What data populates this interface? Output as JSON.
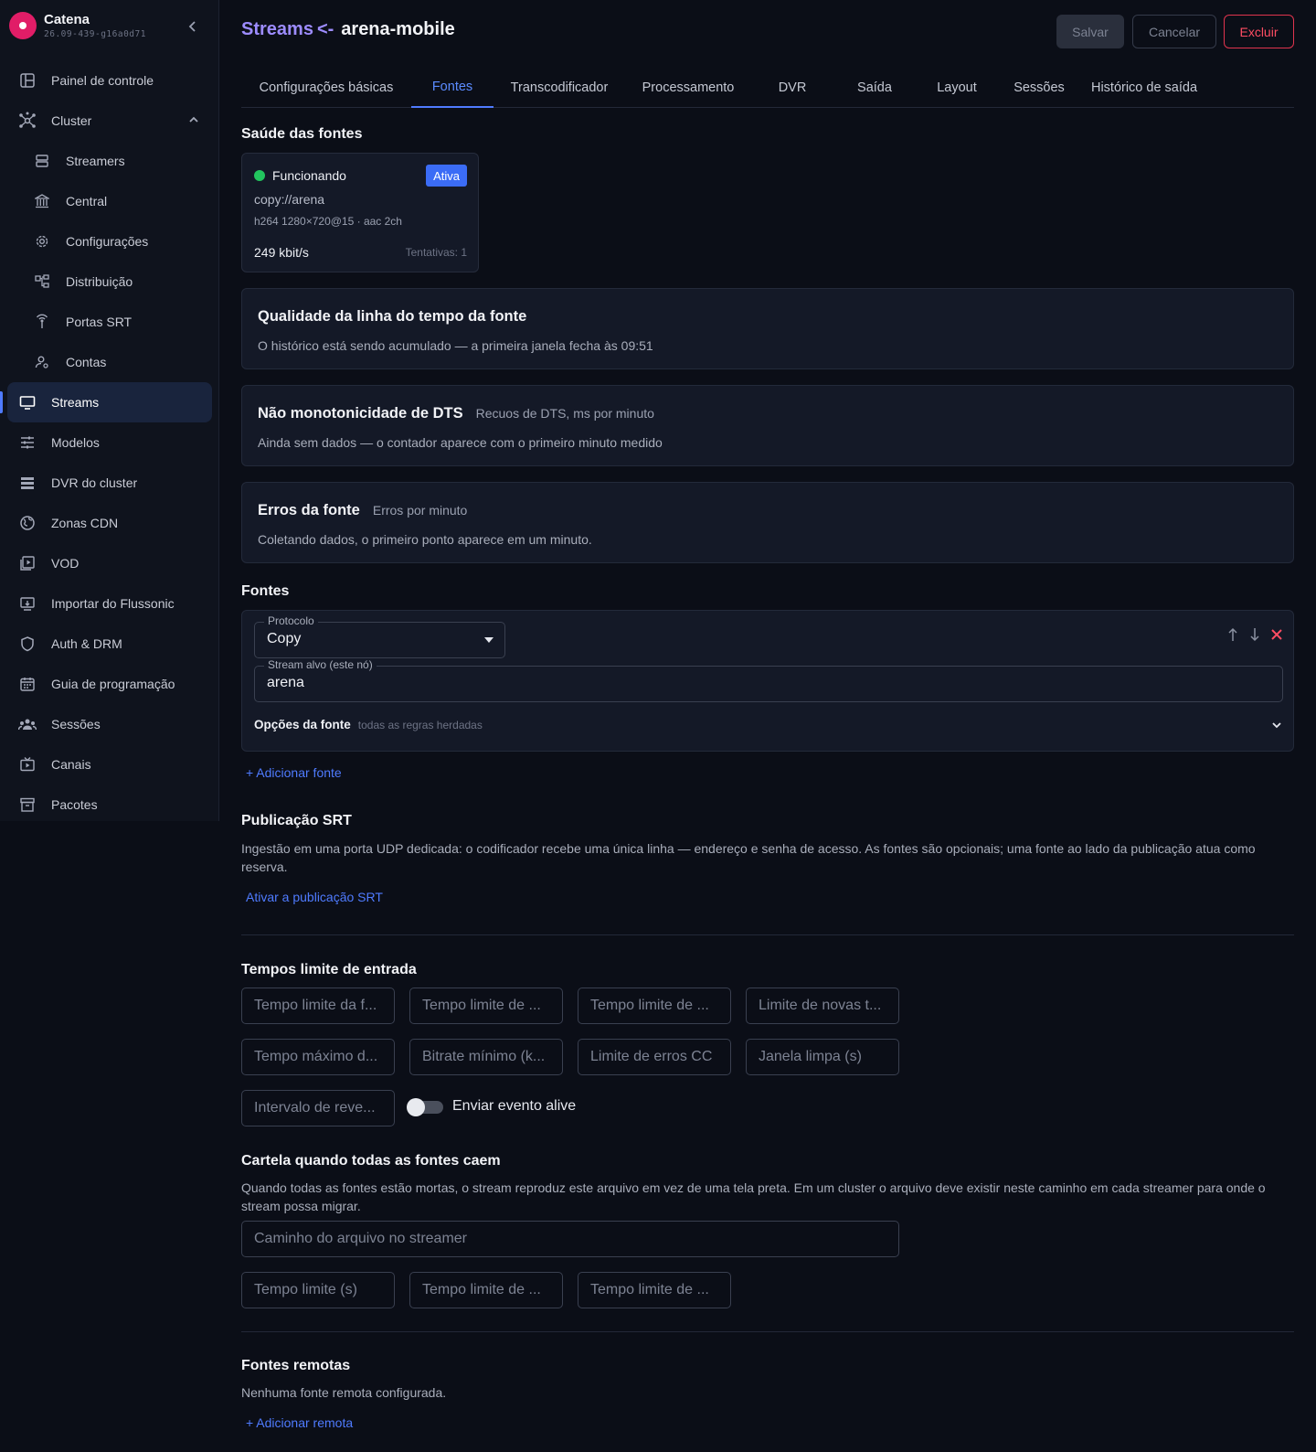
{
  "brand": {
    "name": "Catena",
    "version": "26.09-439-g16a0d71"
  },
  "sidebar": {
    "items": [
      {
        "label": "Painel de controle",
        "icon": "dashboard-icon"
      },
      {
        "label": "Cluster",
        "icon": "cluster-icon",
        "expanded": true
      },
      {
        "label": "Streamers",
        "icon": "server-icon"
      },
      {
        "label": "Central",
        "icon": "bank-icon"
      },
      {
        "label": "Configurações",
        "icon": "gear-icon"
      },
      {
        "label": "Distribuição",
        "icon": "distribution-icon"
      },
      {
        "label": "Portas SRT",
        "icon": "antenna-icon"
      },
      {
        "label": "Contas",
        "icon": "accounts-icon"
      },
      {
        "label": "Streams",
        "icon": "monitor-icon",
        "active": true
      },
      {
        "label": "Modelos",
        "icon": "sliders-icon"
      },
      {
        "label": "DVR do cluster",
        "icon": "storage-icon"
      },
      {
        "label": "Zonas CDN",
        "icon": "globe-icon"
      },
      {
        "label": "VOD",
        "icon": "video-file-icon"
      },
      {
        "label": "Importar do Flussonic",
        "icon": "import-icon"
      },
      {
        "label": "Auth & DRM",
        "icon": "shield-icon"
      },
      {
        "label": "Guia de programação",
        "icon": "calendar-icon"
      },
      {
        "label": "Sessões",
        "icon": "users-icon"
      },
      {
        "label": "Canais",
        "icon": "tv-icon"
      },
      {
        "label": "Pacotes",
        "icon": "archive-icon"
      }
    ]
  },
  "header": {
    "crumb": "Streams",
    "arrow": "<-",
    "stream_name": "arena-mobile",
    "save_label": "Salvar",
    "cancel_label": "Cancelar",
    "delete_label": "Excluir"
  },
  "tabs": [
    {
      "label": "Configurações básicas"
    },
    {
      "label": "Fontes",
      "active": true
    },
    {
      "label": "Transcodificador"
    },
    {
      "label": "Processamento"
    },
    {
      "label": "DVR"
    },
    {
      "label": "Saída"
    },
    {
      "label": "Layout"
    },
    {
      "label": "Sessões"
    },
    {
      "label": "Histórico de saída"
    }
  ],
  "health": {
    "title": "Saúde das fontes",
    "status": "Funcionando",
    "badge": "Ativa",
    "url": "copy://arena",
    "codec": "h264 1280×720@15 · aac 2ch",
    "bitrate": "249 kbit/s",
    "attempts": "Tentativas: 1",
    "status_color": "#22c55e"
  },
  "timeline_quality": {
    "title": "Qualidade da linha do tempo da fonte",
    "text": "O histórico está sendo acumulado — a primeira janela fecha às 09:51"
  },
  "dts": {
    "title": "Não monotonicidade de DTS",
    "subtitle": "Recuos de DTS, ms por minuto",
    "text": "Ainda sem dados — o contador aparece com o primeiro minuto medido"
  },
  "source_errors": {
    "title": "Erros da fonte",
    "subtitle": "Erros por minuto",
    "text": "Coletando dados, o primeiro ponto aparece em um minuto."
  },
  "sources": {
    "title": "Fontes",
    "protocol_label": "Protocolo",
    "protocol_value": "Copy",
    "target_label": "Stream alvo (este nó)",
    "target_value": "arena",
    "options_label": "Opções da fonte",
    "options_hint": "todas as regras herdadas",
    "add_label": "+ Adicionar fonte"
  },
  "srt": {
    "title": "Publicação SRT",
    "text": "Ingestão em uma porta UDP dedicada: o codificador recebe uma única linha — endereço e senha de acesso. As fontes são opcionais; uma fonte ao lado da publicação atua como reserva.",
    "enable_label": "Ativar a publicação SRT"
  },
  "timeouts": {
    "title": "Tempos limite de entrada",
    "fields": [
      "Tempo limite da f...",
      "Tempo limite de ...",
      "Tempo limite de ...",
      "Limite de novas t...",
      "Tempo máximo d...",
      "Bitrate mínimo (k...",
      "Limite de erros CC",
      "Janela limpa (s)",
      "Intervalo de reve..."
    ],
    "alive_label": "Enviar evento alive",
    "alive_enabled": false
  },
  "slate": {
    "title": "Cartela quando todas as fontes caem",
    "text": "Quando todas as fontes estão mortas, o stream reproduz este arquivo em vez de uma tela preta. Em um cluster o arquivo deve existir neste caminho em cada streamer para onde o stream possa migrar.",
    "path_placeholder": "Caminho do arquivo no streamer",
    "fields": [
      "Tempo limite (s)",
      "Tempo limite de ...",
      "Tempo limite de ..."
    ]
  },
  "remote": {
    "title": "Fontes remotas",
    "text": "Nenhuma fonte remota configurada.",
    "add_label": "+ Adicionar remota"
  }
}
